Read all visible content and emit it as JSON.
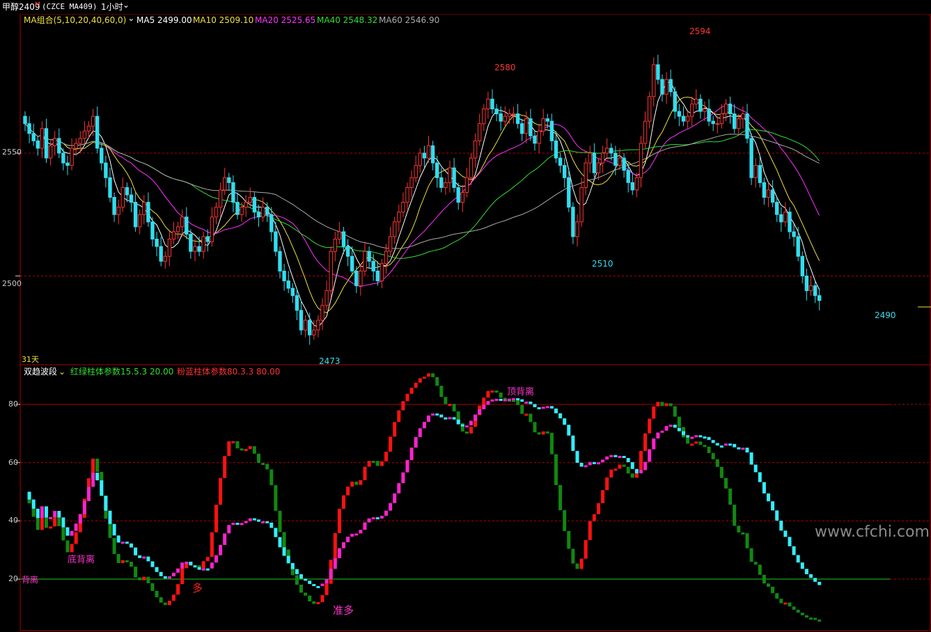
{
  "header": {
    "symbol": "甲醇2409",
    "symbol_mark": "M",
    "code": "(CZCE MA409)",
    "period": "1小时",
    "period_chevron": "⌄"
  },
  "ma_legend": {
    "group_label": "MA组合(5,10,20,40,60,0)",
    "chevron": "⌄",
    "items": [
      {
        "label": "MA5 2499.00",
        "color": "#ffffff"
      },
      {
        "label": "MA10 2509.10",
        "color": "#f0e040"
      },
      {
        "label": "MA20 2525.65",
        "color": "#ff33ff"
      },
      {
        "label": "MA40 2548.32",
        "color": "#33dd33"
      },
      {
        "label": "MA60 2546.90",
        "color": "#aaaaaa"
      }
    ]
  },
  "price_axis": {
    "labels": [
      "2550",
      "2500"
    ]
  },
  "price_marks": {
    "high1": "2580",
    "high2": "2594",
    "low1": "2510",
    "low2": "2473",
    "last": "2490"
  },
  "days_label": "31天",
  "indicator_legend": {
    "name": "双趋波段",
    "chevron": "⌄",
    "param1": "红绿柱体参数15.5.3 20.00",
    "param2": "粉蓝柱体参数80.3.3 80.00"
  },
  "indicator_axis": {
    "labels": [
      "80",
      "60",
      "40",
      "20"
    ]
  },
  "signals": {
    "top_divergence": "顶背离",
    "bottom_divergence": "底背离",
    "divergence_left": "背离",
    "long": "多",
    "pre_long": "准多"
  },
  "watermark": "www.cfchi.com",
  "colors": {
    "up": "#ff3333",
    "down": "#33ddee",
    "red_bar": "#ff1111",
    "green_bar": "#118811",
    "pink_bar": "#ff22cc",
    "cyan_bar": "#33eeff"
  },
  "chart_data": {
    "type": "candlestick",
    "price_range": [
      2465,
      2601
    ],
    "closes": [
      2562,
      2558,
      2555,
      2552,
      2560,
      2548,
      2553,
      2556,
      2550,
      2546,
      2545,
      2552,
      2554,
      2556,
      2559,
      2561,
      2565,
      2552,
      2546,
      2540,
      2532,
      2525,
      2528,
      2536,
      2533,
      2530,
      2520,
      2525,
      2530,
      2522,
      2515,
      2512,
      2506,
      2508,
      2515,
      2518,
      2520,
      2524,
      2517,
      2510,
      2512,
      2510,
      2516,
      2514,
      2524,
      2528,
      2535,
      2540,
      2538,
      2530,
      2525,
      2528,
      2530,
      2532,
      2526,
      2524,
      2528,
      2525,
      2518,
      2510,
      2502,
      2498,
      2495,
      2492,
      2486,
      2478,
      2482,
      2476,
      2478,
      2482,
      2488,
      2494,
      2510,
      2515,
      2518,
      2512,
      2508,
      2502,
      2496,
      2502,
      2510,
      2506,
      2502,
      2498,
      2505,
      2510,
      2516,
      2522,
      2526,
      2530,
      2536,
      2540,
      2545,
      2550,
      2548,
      2553,
      2546,
      2540,
      2536,
      2538,
      2544,
      2536,
      2530,
      2534,
      2540,
      2548,
      2555,
      2562,
      2568,
      2572,
      2568,
      2566,
      2563,
      2565,
      2566,
      2566,
      2562,
      2558,
      2564,
      2557,
      2554,
      2559,
      2564,
      2563,
      2555,
      2548,
      2545,
      2540,
      2528,
      2516,
      2522,
      2536,
      2546,
      2550,
      2542,
      2546,
      2550,
      2552,
      2550,
      2545,
      2548,
      2543,
      2538,
      2535,
      2540,
      2554,
      2563,
      2573,
      2586,
      2580,
      2574,
      2580,
      2575,
      2567,
      2565,
      2563,
      2565,
      2570,
      2572,
      2567,
      2568,
      2563,
      2562,
      2562,
      2566,
      2570,
      2566,
      2560,
      2564,
      2566,
      2556,
      2540,
      2545,
      2538,
      2532,
      2535,
      2530,
      2525,
      2522,
      2526,
      2518,
      2516,
      2508,
      2500,
      2494,
      2496,
      2492,
      2490
    ]
  }
}
